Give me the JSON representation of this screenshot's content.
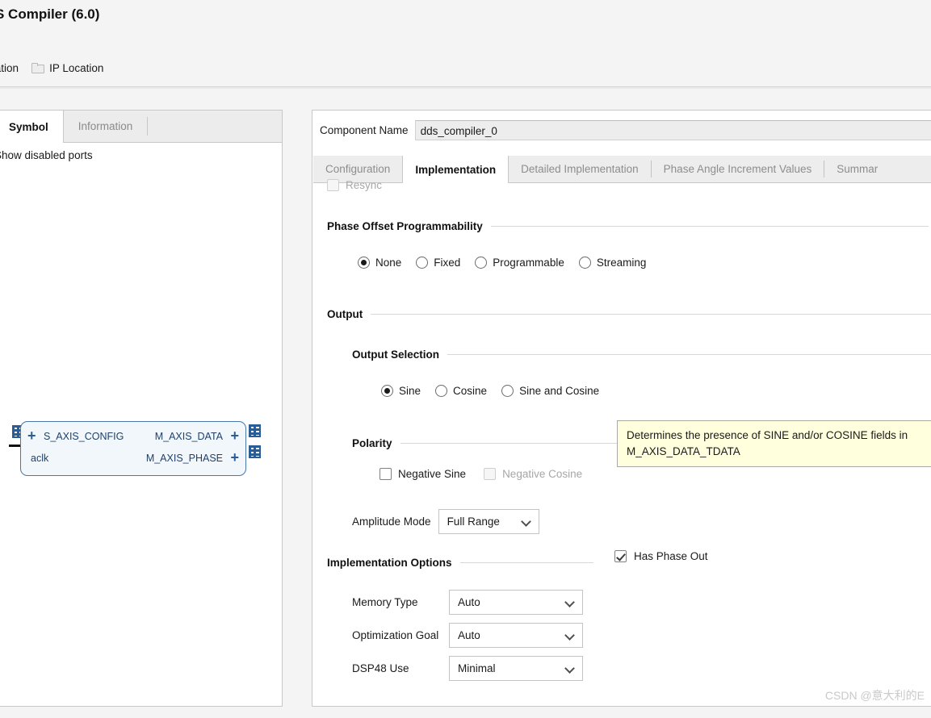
{
  "window": {
    "title": "S Compiler (6.0)"
  },
  "toolbar": {
    "documentation_label": "ocumentation",
    "ip_location_label": "IP Location",
    "folder_icon": "folder-icon"
  },
  "left_panel": {
    "tabs": [
      {
        "label": "Symbol",
        "active": true
      },
      {
        "label": "Information",
        "active": false
      }
    ],
    "show_disabled_ports_label": "Show disabled ports",
    "symbol": {
      "inputs": [
        "S_AXIS_CONFIG",
        "aclk"
      ],
      "outputs": [
        "M_AXIS_DATA",
        "M_AXIS_PHASE"
      ],
      "plus_glyph": "+"
    }
  },
  "main": {
    "component_name_label": "Component Name",
    "component_name_value": "dds_compiler_0",
    "tabs": [
      {
        "label": "Configuration",
        "active": false
      },
      {
        "label": "Implementation",
        "active": true
      },
      {
        "label": "Detailed Implementation",
        "active": false
      },
      {
        "label": "Phase Angle Increment Values",
        "active": false
      },
      {
        "label": "Summar",
        "active": false
      }
    ],
    "resync": {
      "label": "Resync",
      "checked": false,
      "enabled": false
    },
    "phase_offset": {
      "section_title": "Phase Offset Programmability",
      "options": [
        {
          "label": "None",
          "selected": true
        },
        {
          "label": "Fixed",
          "selected": false
        },
        {
          "label": "Programmable",
          "selected": false
        },
        {
          "label": "Streaming",
          "selected": false
        }
      ]
    },
    "output": {
      "section_title": "Output",
      "output_selection": {
        "section_title": "Output Selection",
        "options": [
          {
            "label": "Sine",
            "selected": true
          },
          {
            "label": "Cosine",
            "selected": false
          },
          {
            "label": "Sine and Cosine",
            "selected": false
          }
        ]
      },
      "polarity": {
        "section_title": "Polarity",
        "negative_sine": {
          "label": "Negative Sine",
          "checked": false,
          "enabled": true
        },
        "negative_cosine": {
          "label": "Negative Cosine",
          "checked": false,
          "enabled": false
        }
      },
      "amplitude_mode": {
        "label": "Amplitude Mode",
        "value": "Full Range"
      }
    },
    "implementation_options": {
      "section_title": "Implementation Options",
      "fields": [
        {
          "label": "Memory Type",
          "value": "Auto"
        },
        {
          "label": "Optimization Goal",
          "value": "Auto"
        },
        {
          "label": "DSP48 Use",
          "value": "Minimal"
        }
      ]
    },
    "has_phase_out": {
      "label": "Has Phase Out",
      "checked": true
    }
  },
  "tooltip": {
    "text": "Determines the presence of SINE and/or COSINE fields in M_AXIS_DATA_TDATA"
  },
  "watermark": {
    "text": "CSDN @意大利的E"
  },
  "colors": {
    "panel_bg": "#f4f4f4",
    "panel_white": "#ffffff",
    "tab_bg": "#ededed",
    "border": "#c8c8c8",
    "symbol_fill": "#f2f7fc",
    "symbol_border": "#4a77a8",
    "symbol_text": "#20416b",
    "tooltip_bg": "#ffffdd",
    "disabled_text": "#a7a7a7"
  }
}
